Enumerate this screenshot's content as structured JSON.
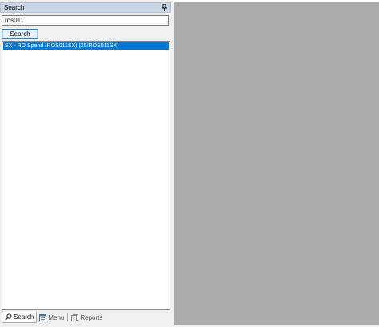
{
  "panel": {
    "title": "Search",
    "pin_icon": "pin-icon"
  },
  "search": {
    "value": "ros011",
    "button_label": "Search"
  },
  "results": [
    "SX - RO Spend (ROS011SX) (25/ROS011SX)"
  ],
  "tabs": [
    {
      "label": "Search",
      "icon": "search-icon",
      "active": true
    },
    {
      "label": "Menu",
      "icon": "menu-icon",
      "active": false
    },
    {
      "label": "Reports",
      "icon": "reports-icon",
      "active": false
    }
  ],
  "colors": {
    "header_bg": "#c9d6e5",
    "selection": "#0078d7",
    "workspace": "#ababab"
  }
}
